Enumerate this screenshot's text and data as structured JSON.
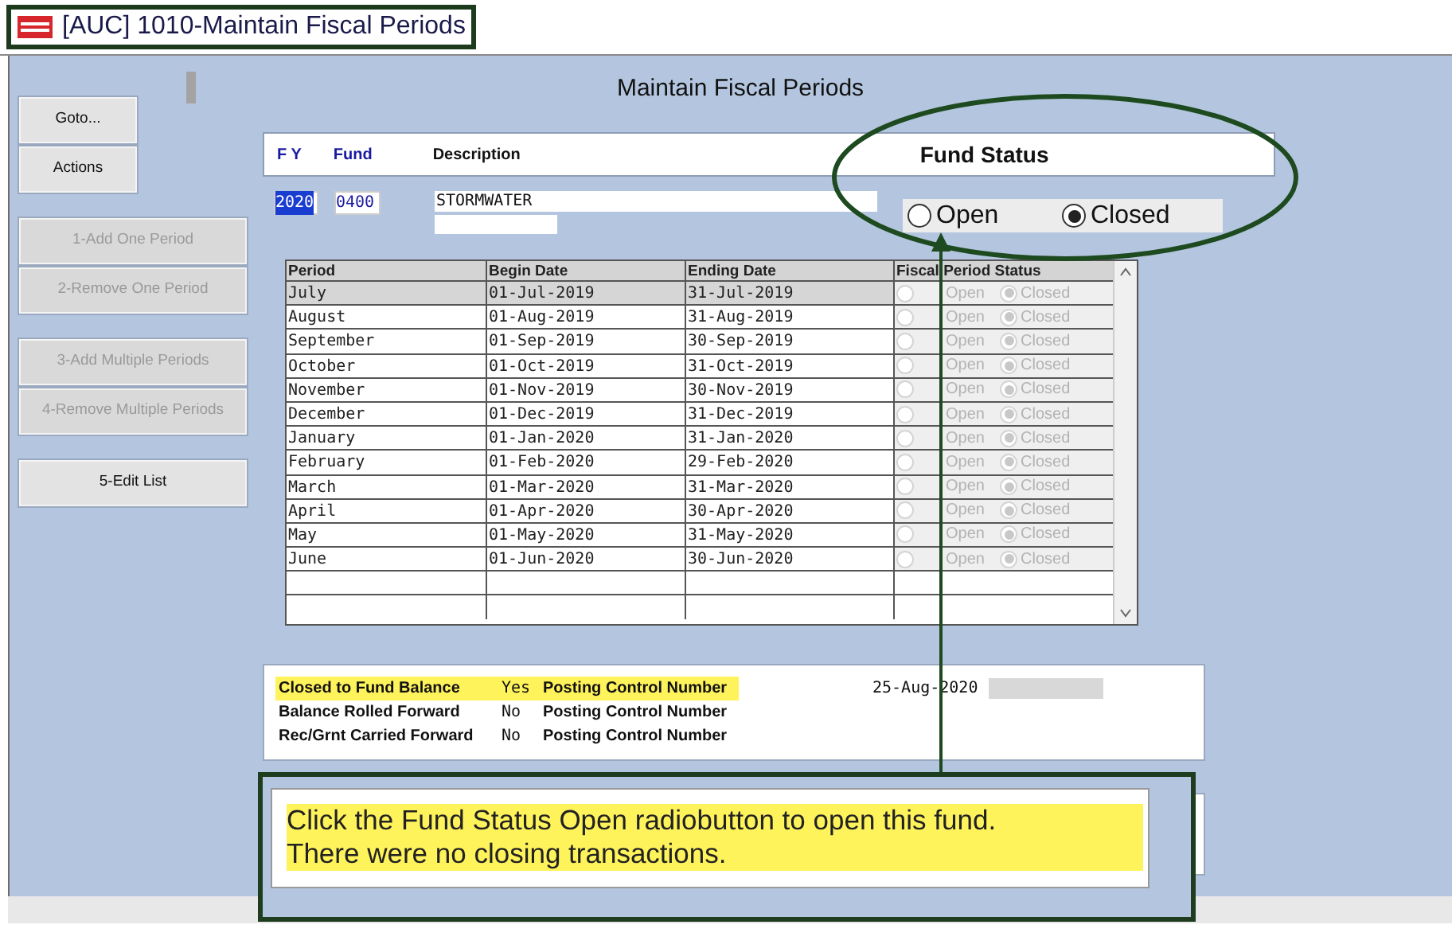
{
  "window": {
    "title": "[AUC] 1010-Maintain Fiscal Periods"
  },
  "page_title": "Maintain Fiscal Periods",
  "side_button_groups": [
    [
      {
        "label": "Goto...",
        "kind": "nav",
        "disabled": false
      },
      {
        "label": "Actions",
        "kind": "nav",
        "disabled": false
      }
    ],
    [
      {
        "label": "1-Add One Period",
        "kind": "action",
        "disabled": true
      },
      {
        "label": "2-Remove One Period",
        "kind": "action",
        "disabled": true
      }
    ],
    [
      {
        "label": "3-Add Multiple Periods",
        "kind": "action",
        "disabled": true
      },
      {
        "label": "4-Remove Multiple Periods",
        "kind": "action",
        "disabled": true
      }
    ],
    [
      {
        "label": "5-Edit List",
        "kind": "action",
        "disabled": false
      }
    ]
  ],
  "header": {
    "fy_label": "F Y",
    "fund_label": "Fund",
    "description_label": "Description"
  },
  "fields": {
    "fy": {
      "value": "2020",
      "highlighted": true
    },
    "fund": {
      "value": "0400"
    },
    "description": {
      "value": "STORMWATER"
    }
  },
  "fund_status": {
    "title": "Fund Status",
    "options": [
      {
        "label": "Open",
        "selected": false
      },
      {
        "label": "Closed",
        "selected": true
      }
    ]
  },
  "table": {
    "columns": [
      "Period",
      "Begin Date",
      "Ending Date",
      "Fiscal Period Status"
    ],
    "status_disabled": true,
    "rows": [
      {
        "period": "July",
        "begin": "01-Jul-2019",
        "end": "31-Jul-2019",
        "selected": true,
        "status": [
          {
            "label": "Open",
            "selected": false
          },
          {
            "label": "Closed",
            "selected": true
          }
        ]
      },
      {
        "period": "August",
        "begin": "01-Aug-2019",
        "end": "31-Aug-2019",
        "selected": false,
        "status": [
          {
            "label": "Open",
            "selected": false
          },
          {
            "label": "Closed",
            "selected": true
          }
        ]
      },
      {
        "period": "September",
        "begin": "01-Sep-2019",
        "end": "30-Sep-2019",
        "selected": false,
        "status": [
          {
            "label": "Open",
            "selected": false
          },
          {
            "label": "Closed",
            "selected": true
          }
        ]
      },
      {
        "period": "October",
        "begin": "01-Oct-2019",
        "end": "31-Oct-2019",
        "selected": false,
        "status": [
          {
            "label": "Open",
            "selected": false
          },
          {
            "label": "Closed",
            "selected": true
          }
        ]
      },
      {
        "period": "November",
        "begin": "01-Nov-2019",
        "end": "30-Nov-2019",
        "selected": false,
        "status": [
          {
            "label": "Open",
            "selected": false
          },
          {
            "label": "Closed",
            "selected": true
          }
        ]
      },
      {
        "period": "December",
        "begin": "01-Dec-2019",
        "end": "31-Dec-2019",
        "selected": false,
        "status": [
          {
            "label": "Open",
            "selected": false
          },
          {
            "label": "Closed",
            "selected": true
          }
        ]
      },
      {
        "period": "January",
        "begin": "01-Jan-2020",
        "end": "31-Jan-2020",
        "selected": false,
        "status": [
          {
            "label": "Open",
            "selected": false
          },
          {
            "label": "Closed",
            "selected": true
          }
        ]
      },
      {
        "period": "February",
        "begin": "01-Feb-2020",
        "end": "29-Feb-2020",
        "selected": false,
        "status": [
          {
            "label": "Open",
            "selected": false
          },
          {
            "label": "Closed",
            "selected": true
          }
        ]
      },
      {
        "period": "March",
        "begin": "01-Mar-2020",
        "end": "31-Mar-2020",
        "selected": false,
        "status": [
          {
            "label": "Open",
            "selected": false
          },
          {
            "label": "Closed",
            "selected": true
          }
        ]
      },
      {
        "period": "April",
        "begin": "01-Apr-2020",
        "end": "30-Apr-2020",
        "selected": false,
        "status": [
          {
            "label": "Open",
            "selected": false
          },
          {
            "label": "Closed",
            "selected": true
          }
        ]
      },
      {
        "period": "May",
        "begin": "01-May-2020",
        "end": "31-May-2020",
        "selected": false,
        "status": [
          {
            "label": "Open",
            "selected": false
          },
          {
            "label": "Closed",
            "selected": true
          }
        ]
      },
      {
        "period": "June",
        "begin": "01-Jun-2020",
        "end": "30-Jun-2020",
        "selected": false,
        "status": [
          {
            "label": "Open",
            "selected": false
          },
          {
            "label": "Closed",
            "selected": true
          }
        ]
      }
    ]
  },
  "closing_info": [
    {
      "label": "Closed to Fund Balance",
      "value": "Yes",
      "pcn_label": "Posting Control Number",
      "highlighted": true,
      "date": "25-Aug-2020",
      "redacted": true
    },
    {
      "label": "Balance Rolled Forward",
      "value": "No",
      "pcn_label": "Posting Control Number",
      "highlighted": false
    },
    {
      "label": "Rec/Grnt Carried Forward",
      "value": "No",
      "pcn_label": "Posting Control Number",
      "highlighted": false
    }
  ],
  "callout": {
    "lines": [
      "Click the Fund Status Open radiobutton to open this fund.",
      "There were no closing transactions."
    ]
  }
}
